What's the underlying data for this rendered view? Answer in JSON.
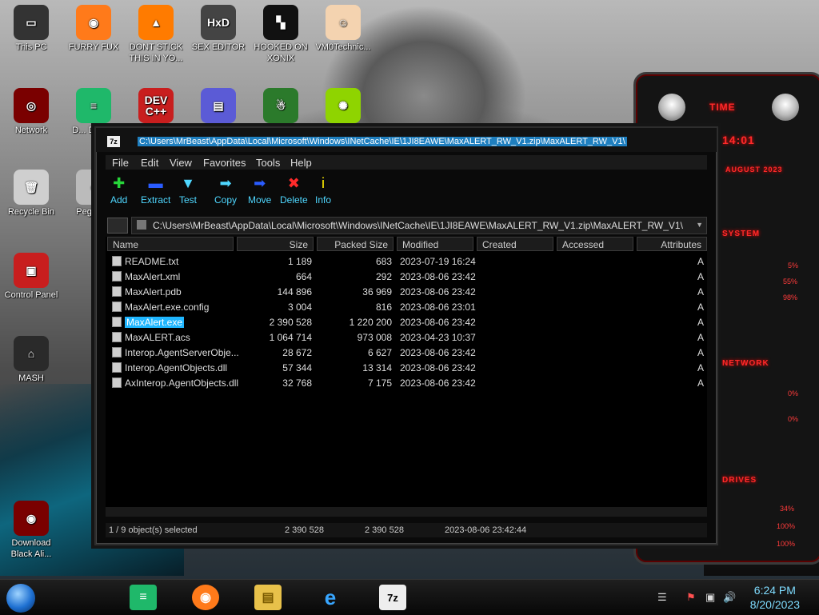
{
  "desktop": {
    "icons": [
      {
        "label": "This PC",
        "glyph": "▭"
      },
      {
        "label": "FURRY FUX",
        "glyph": "◉"
      },
      {
        "label": "DONT STICK THIS IN YO...",
        "glyph": "▲"
      },
      {
        "label": "SEX EDITOR",
        "glyph": "HxD"
      },
      {
        "label": "HOOKED ON XONIX",
        "glyph": "▚"
      },
      {
        "label": "VM0Technic...",
        "glyph": "☺"
      },
      {
        "label": "Network",
        "glyph": "◎"
      },
      {
        "label": "D... DUN...",
        "glyph": "≡"
      },
      {
        "label": "",
        "glyph": "DEV C++"
      },
      {
        "label": "",
        "glyph": "▤"
      },
      {
        "label": "",
        "glyph": "☃"
      },
      {
        "label": "",
        "glyph": "✺"
      },
      {
        "label": "Recycle Bin",
        "glyph": "🗑"
      },
      {
        "label": "Peggle...",
        "glyph": "◐"
      },
      {
        "label": "Control Panel",
        "glyph": "▣"
      },
      {
        "label": "MASH",
        "glyph": "⌂"
      },
      {
        "label": "Download Black Ali...",
        "glyph": "◉"
      }
    ]
  },
  "gadget": {
    "time_label": "TIME",
    "time_value": "14:01",
    "date_value": "AUGUST 2023",
    "system_label": "SYSTEM",
    "system_pcts": [
      "5%",
      "55%",
      "98%"
    ],
    "network_label": "NETWORK",
    "network_pcts": [
      "0%",
      "0%"
    ],
    "drives_label": "DRIVES",
    "drive_pcts": [
      "34%",
      "100%",
      "100%"
    ]
  },
  "window": {
    "title_icon": "7z",
    "title": "C:\\Users\\MrBeast\\AppData\\Local\\Microsoft\\Windows\\INetCache\\IE\\1JI8EAWE\\MaxALERT_RW_V1.zip\\MaxALERT_RW_V1\\",
    "menu": [
      "File",
      "Edit",
      "View",
      "Favorites",
      "Tools",
      "Help"
    ],
    "toolbar": [
      {
        "label": "Add",
        "icon": "plus-icon",
        "glyph": "✚",
        "color": "#27d53a"
      },
      {
        "label": "Extract",
        "icon": "minus-icon",
        "glyph": "▬",
        "color": "#2a5cff"
      },
      {
        "label": "Test",
        "icon": "check-icon",
        "glyph": "▼",
        "color": "#4fd7ff"
      },
      {
        "label": "Copy",
        "icon": "copy-arrow-icon",
        "glyph": "➡",
        "color": "#4fd7ff"
      },
      {
        "label": "Move",
        "icon": "move-arrow-icon",
        "glyph": "➡",
        "color": "#2a5cff"
      },
      {
        "label": "Delete",
        "icon": "delete-x-icon",
        "glyph": "✖",
        "color": "#ff2a2a"
      },
      {
        "label": "Info",
        "icon": "info-icon",
        "glyph": "i",
        "color": "#ffee00"
      }
    ],
    "address": "C:\\Users\\MrBeast\\AppData\\Local\\Microsoft\\Windows\\INetCache\\IE\\1JI8EAWE\\MaxALERT_RW_V1.zip\\MaxALERT_RW_V1\\",
    "columns": [
      "Name",
      "Size",
      "Packed Size",
      "Modified",
      "Created",
      "Accessed",
      "Attributes"
    ],
    "files": [
      {
        "name": "README.txt",
        "size": "1 189",
        "packed": "683",
        "modified": "2023-07-19 16:24",
        "attr": "A",
        "selected": false
      },
      {
        "name": "MaxAlert.xml",
        "size": "664",
        "packed": "292",
        "modified": "2023-08-06 23:42",
        "attr": "A",
        "selected": false
      },
      {
        "name": "MaxAlert.pdb",
        "size": "144 896",
        "packed": "36 969",
        "modified": "2023-08-06 23:42",
        "attr": "A",
        "selected": false
      },
      {
        "name": "MaxAlert.exe.config",
        "size": "3 004",
        "packed": "816",
        "modified": "2023-08-06 23:01",
        "attr": "A",
        "selected": false
      },
      {
        "name": "MaxAlert.exe",
        "size": "2 390 528",
        "packed": "1 220 200",
        "modified": "2023-08-06 23:42",
        "attr": "A",
        "selected": true
      },
      {
        "name": "MaxALERT.acs",
        "size": "1 064 714",
        "packed": "973 008",
        "modified": "2023-04-23 10:37",
        "attr": "A",
        "selected": false
      },
      {
        "name": "Interop.AgentServerObje...",
        "size": "28 672",
        "packed": "6 627",
        "modified": "2023-08-06 23:42",
        "attr": "A",
        "selected": false
      },
      {
        "name": "Interop.AgentObjects.dll",
        "size": "57 344",
        "packed": "13 314",
        "modified": "2023-08-06 23:42",
        "attr": "A",
        "selected": false
      },
      {
        "name": "AxInterop.AgentObjects.dll",
        "size": "32 768",
        "packed": "7 175",
        "modified": "2023-08-06 23:42",
        "attr": "A",
        "selected": false
      }
    ],
    "status": {
      "selection": "1 / 9 object(s) selected",
      "size": "2 390 528",
      "packed": "2 390 528",
      "modified": "2023-08-06 23:42:44"
    }
  },
  "taskbar": {
    "time": "6:24 PM",
    "date": "8/20/2023"
  }
}
